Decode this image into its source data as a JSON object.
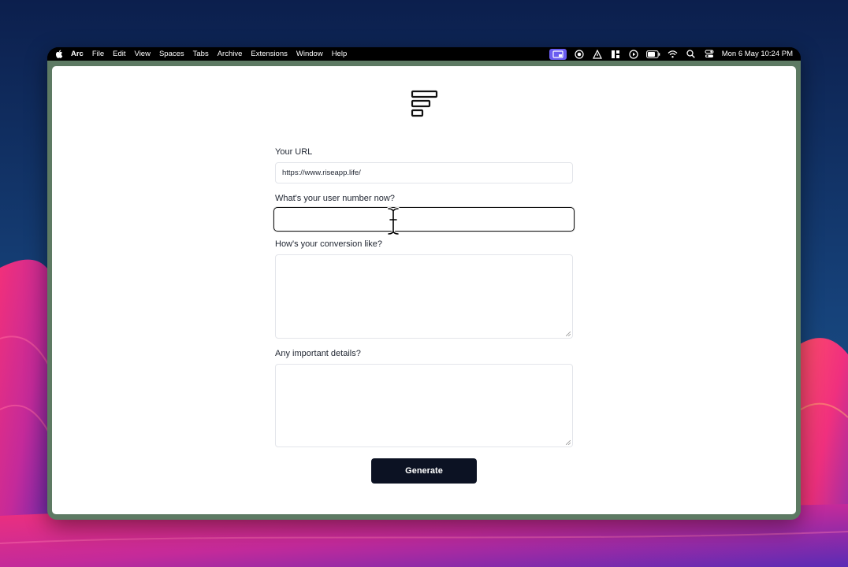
{
  "menubar": {
    "app_name": "Arc",
    "items": [
      "File",
      "Edit",
      "View",
      "Spaces",
      "Tabs",
      "Archive",
      "Extensions",
      "Window",
      "Help"
    ],
    "status_icons": [
      "screen-mirror-icon",
      "record-icon",
      "vpn-icon",
      "layout-icon",
      "play-icon",
      "battery-icon",
      "wifi-icon",
      "search-icon",
      "control-center-icon"
    ],
    "clock": "Mon 6 May  10:24 PM"
  },
  "form": {
    "url_label": "Your URL",
    "url_value": "https://www.riseapp.life/",
    "users_label": "What's your user number now?",
    "users_value": "",
    "conversion_label": "How's your conversion like?",
    "conversion_value": "",
    "details_label": "Any important details?",
    "details_value": "",
    "generate_label": "Generate"
  },
  "colors": {
    "accent_active": "#6a5cf0",
    "button_bg": "#0c1223",
    "window_frame": "#5d7a63"
  }
}
